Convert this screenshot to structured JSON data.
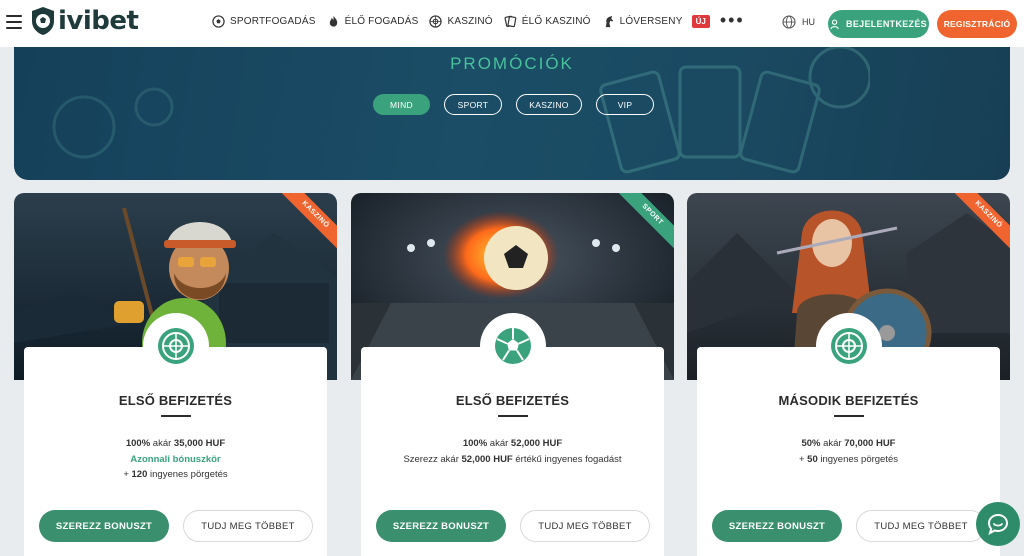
{
  "header": {
    "logo_text": "ivibet",
    "nav": [
      {
        "label": "SPORTFOGADÁS",
        "icon": "soccer-ball-icon"
      },
      {
        "label": "ÉLŐ FOGADÁS",
        "icon": "live-flame-icon"
      },
      {
        "label": "KASZINÓ",
        "icon": "roulette-icon"
      },
      {
        "label": "ÉLŐ KASZINÓ",
        "icon": "live-cards-icon"
      },
      {
        "label": "LÓVERSENY",
        "icon": "horse-icon"
      }
    ],
    "new_badge": "ÚJ",
    "more": "•••",
    "language": "HU",
    "login_label": "BEJELENTKEZÉS",
    "register_label": "REGISZTRÁCIÓ"
  },
  "hero": {
    "title": "PROMÓCIÓK",
    "filters": [
      {
        "label": "MIND",
        "active": true
      },
      {
        "label": "SPORT",
        "active": false
      },
      {
        "label": "KASZINO",
        "active": false
      },
      {
        "label": "VIP",
        "active": false
      }
    ]
  },
  "cards": [
    {
      "ribbon": "KASZINÓ",
      "icon": "roulette-icon",
      "title": "ELSŐ BEFIZETÉS",
      "line1_bold": "100%",
      "line1_mid": " akár ",
      "line1_value": "35,000 HUF",
      "line2": "Azonnali bónuszkör",
      "line3_prefix": "+ ",
      "line3_bold": "120",
      "line3_rest": " ingyenes pörgetés",
      "bonus_label": "SZEREZZ BONUSZT",
      "more_label": "TUDJ MEG TÖBBET"
    },
    {
      "ribbon": "SPORT",
      "icon": "soccer-ball-icon",
      "title": "ELSŐ BEFIZETÉS",
      "line1_bold": "100%",
      "line1_mid": " akár ",
      "line1_value": "52,000 HUF",
      "line2_prefix": "Szerezz akár ",
      "line2_bold": "52,000 HUF",
      "line2_rest": " értékű ingyenes fogadást",
      "bonus_label": "SZEREZZ BONUSZT",
      "more_label": "TUDJ MEG TÖBBET"
    },
    {
      "ribbon": "KASZINÓ",
      "icon": "roulette-icon",
      "title": "MÁSODIK BEFIZETÉS",
      "line1_bold": "50%",
      "line1_mid": " akár ",
      "line1_value": "70,000 HUF",
      "line2_prefix": "+ ",
      "line2_bold": "50",
      "line2_rest": " ingyenes pörgetés",
      "bonus_label": "SZEREZZ BONUSZT",
      "more_label": "TUDJ MEG TÖBBET"
    }
  ],
  "colors": {
    "accent_green": "#3aa37e",
    "accent_orange": "#f0652f",
    "hero_blue": "#1b4d66"
  }
}
